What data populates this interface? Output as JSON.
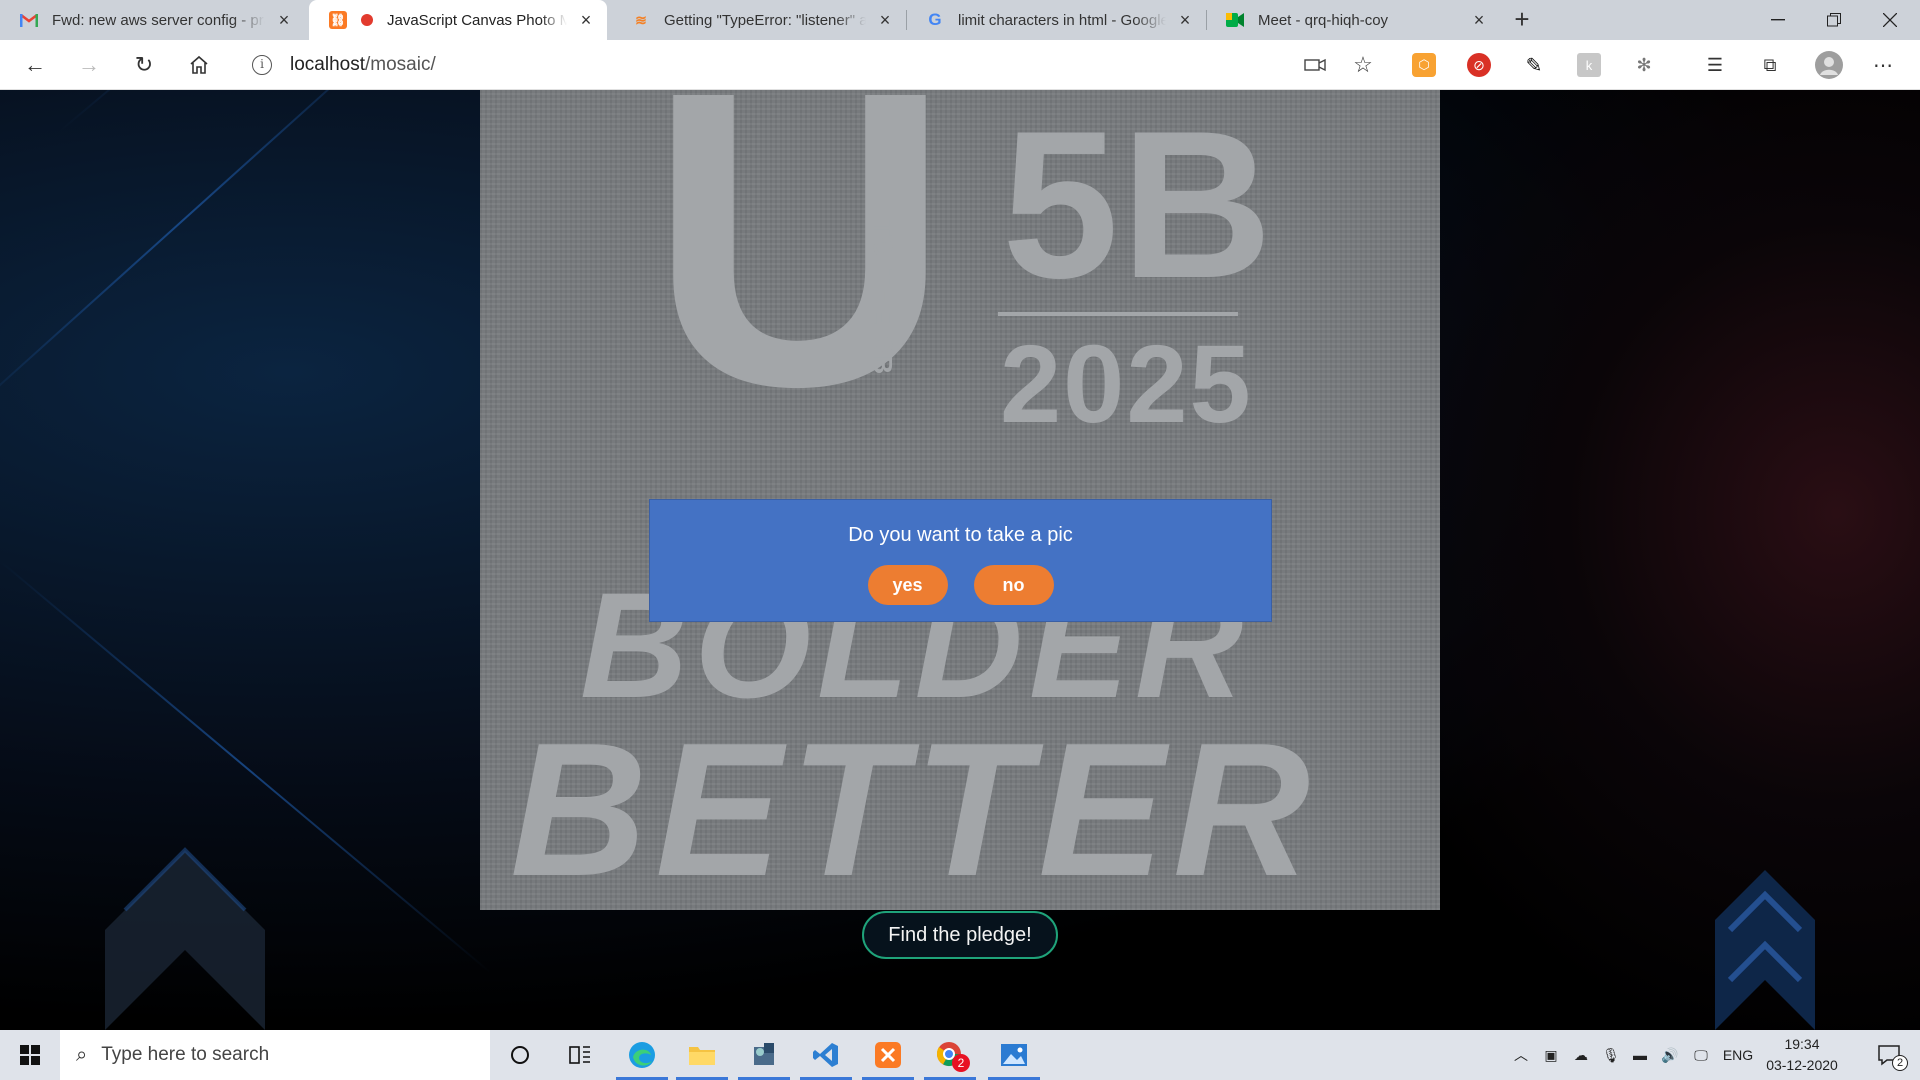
{
  "browser": {
    "tabs": [
      {
        "title": "Fwd: new aws server config - pra",
        "icon": "gmail-icon"
      },
      {
        "title": "JavaScript Canvas Photo Mosaic",
        "icon": "xampp-icon",
        "recording": true
      },
      {
        "title": "Getting \"TypeError: \"listener\" arg",
        "icon": "stackoverflow-icon"
      },
      {
        "title": "limit characters in html - Google",
        "icon": "google-icon"
      },
      {
        "title": "Meet - qrq-hiqh-coy",
        "icon": "google-meet-icon"
      }
    ],
    "url_host": "localhost",
    "url_path": "/mosaic/"
  },
  "page": {
    "mosaic_text": {
      "line1_left": "U",
      "line1_right": "5B",
      "year": "2025",
      "vertical": "TO THE SB",
      "line2": "BOLDER",
      "line3": "BETTER"
    },
    "dialog": {
      "question": "Do you want to take a pic",
      "yes_label": "yes",
      "no_label": "no"
    },
    "pledge_button": "Find the pledge!"
  },
  "taskbar": {
    "search_placeholder": "Type here to search",
    "language": "ENG",
    "time": "19:34",
    "date": "03-12-2020",
    "notification_count": "2",
    "chrome_badge": "2"
  },
  "colors": {
    "dialog_bg": "#4472c4",
    "pill_bg": "#ed7d31",
    "pledge_border": "#1fa37a"
  }
}
